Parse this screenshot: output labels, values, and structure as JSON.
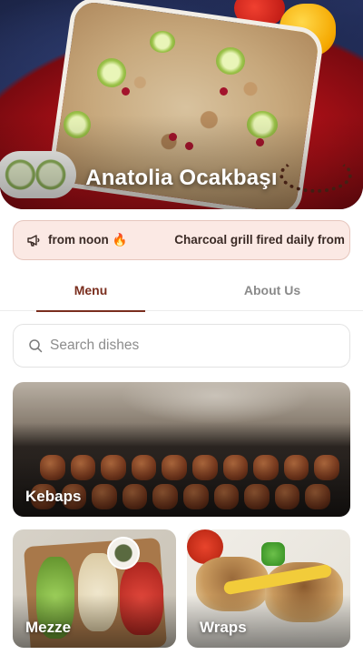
{
  "restaurant": {
    "name": "Anatolia Ocakbaşı"
  },
  "announcement": {
    "icon": "megaphone-icon",
    "items": [
      "from noon 🔥",
      "Charcoal grill fired daily from"
    ]
  },
  "tabs": [
    {
      "label": "Menu",
      "active": true
    },
    {
      "label": "About Us",
      "active": false
    }
  ],
  "search": {
    "placeholder": "Search dishes",
    "value": ""
  },
  "categories": [
    {
      "label": "Kebaps"
    },
    {
      "label": "Mezze"
    },
    {
      "label": "Wraps"
    }
  ],
  "colors": {
    "accent": "#7a2e1e",
    "announcement_bg": "#fbe9e4"
  }
}
